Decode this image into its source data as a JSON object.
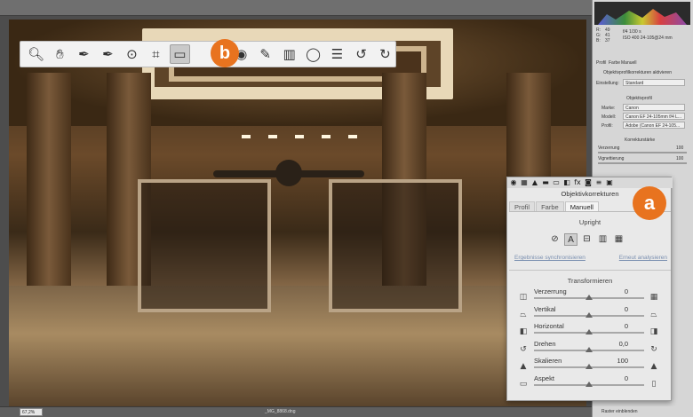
{
  "toolbar": {
    "tools": [
      {
        "name": "zoom-tool-icon",
        "glyph": "🔍︎"
      },
      {
        "name": "hand-tool-icon",
        "glyph": "✋︎"
      },
      {
        "name": "white-balance-tool-icon",
        "glyph": "✒"
      },
      {
        "name": "color-sampler-tool-icon",
        "glyph": "✒"
      },
      {
        "name": "target-adjustment-tool-icon",
        "glyph": "⊙"
      },
      {
        "name": "crop-tool-icon",
        "glyph": "⌗"
      },
      {
        "name": "straighten-tool-icon",
        "glyph": "▭"
      }
    ],
    "tools_after": [
      {
        "name": "red-eye-tool-icon",
        "glyph": "◉"
      },
      {
        "name": "adjustment-brush-icon",
        "glyph": "✎"
      },
      {
        "name": "graduated-filter-icon",
        "glyph": "▥"
      },
      {
        "name": "radial-filter-icon",
        "glyph": "◯"
      },
      {
        "name": "preferences-icon",
        "glyph": "☰"
      },
      {
        "name": "rotate-left-icon",
        "glyph": "↺"
      },
      {
        "name": "rotate-right-icon",
        "glyph": "↻"
      }
    ],
    "badge": "b"
  },
  "lens_panel": {
    "badge": "a",
    "tab_icons": [
      "◉",
      "▦",
      "▲",
      "▬",
      "▭",
      "◧",
      "fx",
      "◙",
      "≡",
      "▣"
    ],
    "title": "Objektivkorrekturen",
    "subtabs": [
      "Profil",
      "Farbe",
      "Manuell"
    ],
    "active_subtab": "Manuell",
    "upright_title": "Upright",
    "upright_buttons": [
      "⊘",
      "A",
      "⊟",
      "▥",
      "▦"
    ],
    "link_sync": "Ergebnisse synchronisieren",
    "link_reanalyze": "Erneut analysieren",
    "transform_title": "Transformieren",
    "rows": [
      {
        "label": "Verzerrung",
        "value": "0",
        "icon_left": "◫",
        "icon_right": "▦",
        "level": 0.5
      },
      {
        "label": "Vertikal",
        "value": "0",
        "icon_left": "⏢",
        "icon_right": "⏢",
        "level": 0.5
      },
      {
        "label": "Horizontal",
        "value": "0",
        "icon_left": "◧",
        "icon_right": "◨",
        "level": 0.5
      },
      {
        "label": "Drehen",
        "value": "0,0",
        "icon_left": "↺",
        "icon_right": "↻",
        "level": 0.5
      },
      {
        "label": "Skalieren",
        "value": "100",
        "icon_left": "▲",
        "icon_right": "▲",
        "level": 0.5
      },
      {
        "label": "Aspekt",
        "value": "0",
        "icon_left": "▭",
        "icon_right": "▯",
        "level": 0.5
      }
    ]
  },
  "right_panel": {
    "readout_r": "R:",
    "readout_g": "G:",
    "readout_b": "B:",
    "r_value": "49",
    "g_value": "41",
    "b_value": "37",
    "camera_info_1": "f/4   1/30 s",
    "camera_info_2": "ISO 400   24-105@24 mm",
    "lens_tab_1": "Profil",
    "lens_tab_2": "Farbe",
    "lens_tab_3": "Manuell",
    "profile_check": "Objektivprofilkorrekturen aktivieren",
    "setup_label": "Einstellung:",
    "setup_value": "Standard",
    "lens_profile_title": "Objektivprofil",
    "make_label": "Marke:",
    "make_value": "Canon",
    "model_label": "Modell:",
    "model_value": "Canon EF 24-105mm f/4 L...",
    "profile_label": "Profil:",
    "profile_value": "Adobe (Canon EF 24-105...",
    "correction_title": "Korrekturstärke",
    "distortion_label": "Verzerrung",
    "distortion_value": "100",
    "vignetting_label": "Vignettierung",
    "vignetting_value": "100"
  },
  "bottom": {
    "zoom": "67,2%",
    "filename": "_MG_8868.dng",
    "right_label": "Raster einblenden"
  },
  "colors": {
    "accent_badge": "#e8731f",
    "panel_bg": "#e9e9e9"
  }
}
